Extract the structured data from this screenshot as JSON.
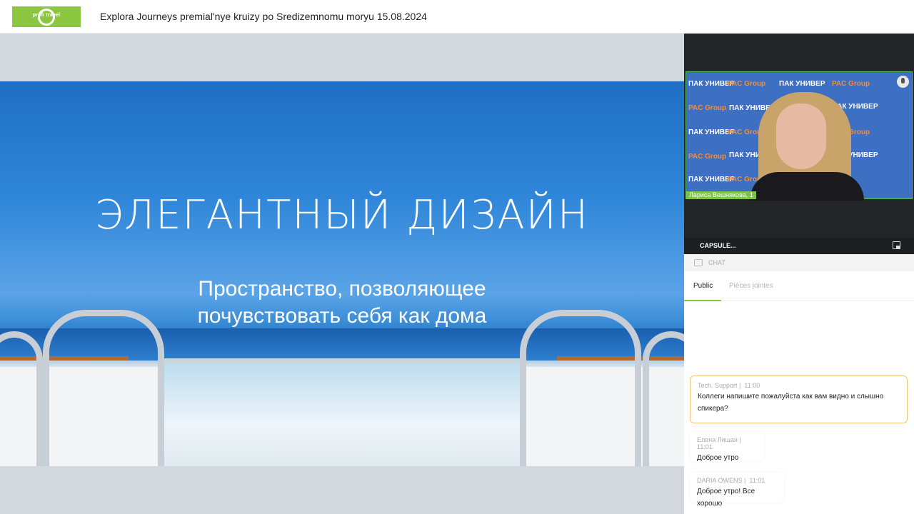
{
  "header": {
    "logo_text": "profi travel",
    "title": "Explora Journeys premial'nye kruizy po Sredizemnomu moryu 15.08.2024"
  },
  "slide": {
    "heading": "ЭЛЕГАНТНЫЙ ДИЗАЙН",
    "subtitle_line1": "Пространство, позволяющее",
    "subtitle_line2": "почувствовать себя как дома"
  },
  "video": {
    "backdrop_brands": [
      "ПАК УНИВЕР",
      "PAC Group"
    ],
    "speaker_name": "Лариса Вешнякова, 1",
    "capsule_label": "CAPSULE..."
  },
  "chat": {
    "title": "CHAT",
    "tabs": [
      {
        "label": "Public",
        "active": true
      },
      {
        "label": "Pièces jointes",
        "active": false
      }
    ],
    "messages": [
      {
        "author": "Tech. Support",
        "time": "11:00",
        "text": "Коллеги напишите пожалуйста как вам видно и слышно спикера?"
      },
      {
        "author": "Елена Лишан",
        "time": "11:01",
        "text": "Доброе утро"
      },
      {
        "author": "DARIA OWENS",
        "time": "11:01",
        "text": "Доброе утро! Все хорошо"
      }
    ]
  },
  "colors": {
    "brand_green": "#8cc63f",
    "highlight_border": "#f5c27a",
    "backdrop_blue": "#3d6fc2",
    "brand_orange": "#ff8a2a"
  },
  "icons": [
    "mic-icon",
    "picture-in-picture-icon",
    "chat-icon"
  ]
}
